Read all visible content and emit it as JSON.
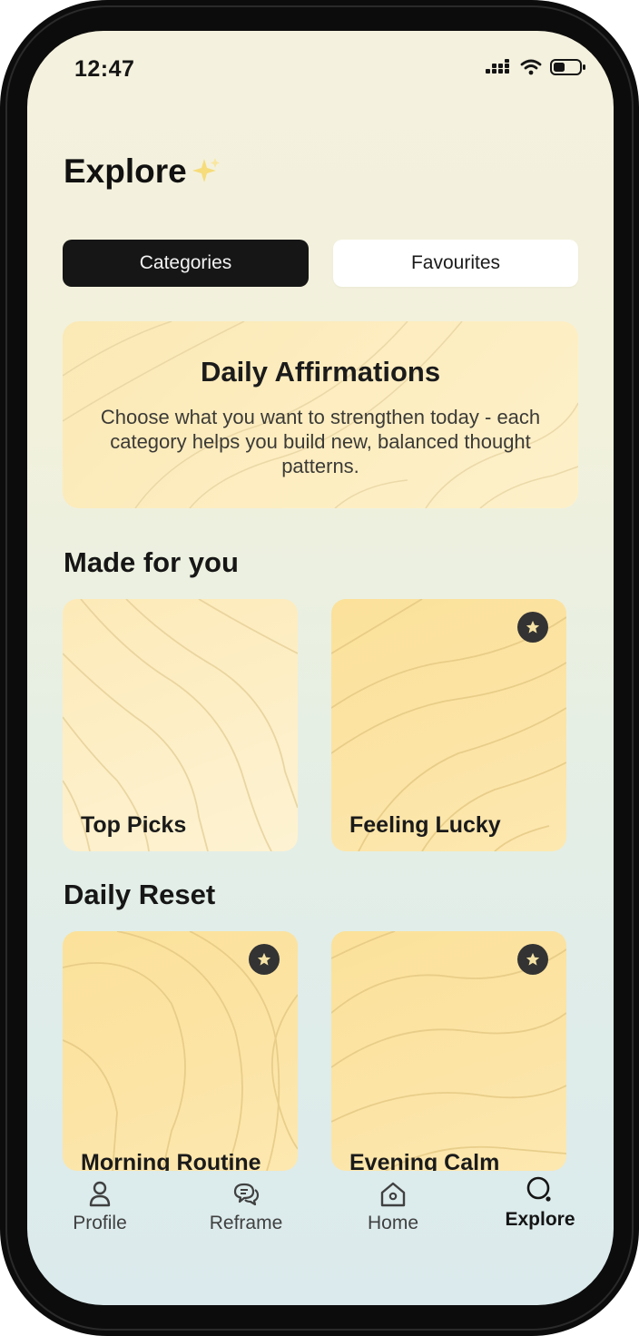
{
  "status_bar": {
    "time": "12:47",
    "icons": [
      "signal-icon",
      "wifi-icon",
      "battery-icon"
    ]
  },
  "header": {
    "title": "Explore",
    "title_icon": "sparkles-icon"
  },
  "tabs": [
    {
      "label": "Categories",
      "active": true
    },
    {
      "label": "Favourites",
      "active": false
    }
  ],
  "hero": {
    "title": "Daily Affirmations",
    "text": "Choose what you want to strengthen today - each category helps you build new, balanced thought patterns."
  },
  "sections": [
    {
      "title": "Made for you",
      "cards": [
        {
          "label": "Top Picks",
          "starred": false
        },
        {
          "label": "Feeling Lucky",
          "starred": true
        }
      ]
    },
    {
      "title": "Daily Reset",
      "cards": [
        {
          "label": "Morning Routine",
          "starred": true
        },
        {
          "label": "Evening Calm",
          "starred": true
        }
      ]
    }
  ],
  "nav": [
    {
      "label": "Profile",
      "icon": "profile-icon",
      "active": false
    },
    {
      "label": "Reframe",
      "icon": "chat-bubbles-icon",
      "active": false
    },
    {
      "label": "Home",
      "icon": "home-icon",
      "active": false
    },
    {
      "label": "Explore",
      "icon": "search-icon",
      "active": true
    }
  ],
  "colors": {
    "accent_dark": "#161616",
    "card_yellow": "#fbe19a",
    "card_light": "#fdeab8",
    "badge": "#333333"
  }
}
